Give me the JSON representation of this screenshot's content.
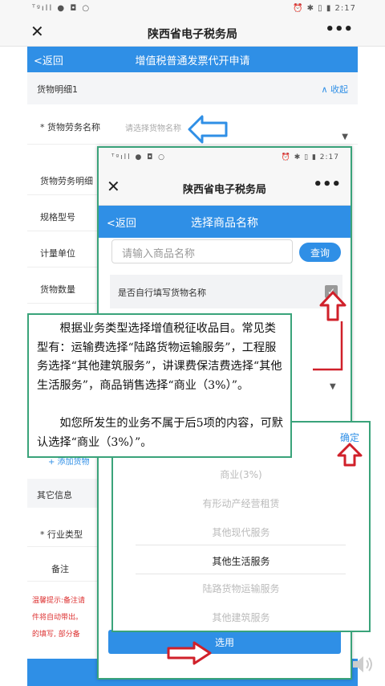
{
  "statusbar": {
    "left": "ᵀᵍıll ● ◘ ○",
    "right": "⏰ ✱ ▯ ▮ 2:17"
  },
  "app_title": "陕西省电子税务局",
  "back_label": "<返回",
  "back_screen": {
    "nav_title": "增值税普通发票代开申请",
    "section_title": "货物明细1",
    "collapse_label": "∧ 收起",
    "goods_name_label": "* 货物劳务名称",
    "goods_name_placeholder": "请选择货物名称",
    "rows": [
      "货物劳务明细",
      "规格型号",
      "计量单位",
      "货物数量"
    ],
    "add_goods": "+ 添加货物",
    "other_info": "其它信息",
    "industry_label": "* 行业类型",
    "remark_label": "备注",
    "warning_lines": [
      "温馨提示:备注请",
      "件将自动带出。",
      "的填写, 部分备"
    ]
  },
  "overlay_screen": {
    "statusbar_left": "ᵀᵍıll ● ◘ ○",
    "statusbar_right": "⏰ ✱ ▯ ▮ 2:17",
    "nav_title": "选择商品名称",
    "search_placeholder": "请输入商品名称",
    "search_button": "查询",
    "self_fill_label": "是否自行填写货物名称",
    "checkbox_mark": "✓",
    "select_button": "选用"
  },
  "picker": {
    "confirm_label": "确定",
    "options": [
      "商业(3%)",
      "有形动产经营租赁",
      "其他现代服务",
      "其他生活服务",
      "陆路货物运输服务",
      "其他建筑服务"
    ],
    "selected_index": 3
  },
  "note": {
    "paragraph1": "根据业务类型选择增值税征收品目。常见类型有：运输费选择“陆路货物运输服务”，工程服务选择“其他建筑服务”，讲课费保洁费选择“其他生活服务”，商品销售选择“商业（3%）”。",
    "paragraph2": "如您所发生的业务不属于后5项的内容，可默认选择“商业（3%）”。"
  },
  "icons": {
    "close": "✕",
    "more": "•••",
    "dropdown": "▼"
  },
  "colors": {
    "accent": "#2f8fe6",
    "frame": "#3aa37a",
    "arrow_red": "#d0202a"
  }
}
